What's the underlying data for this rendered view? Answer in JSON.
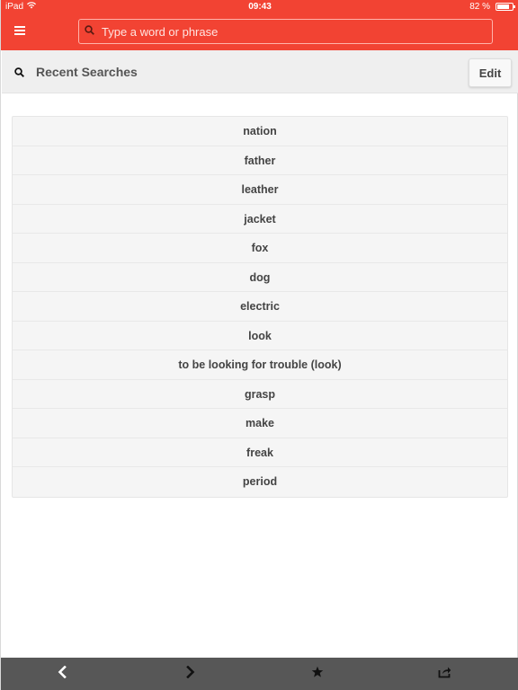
{
  "status_bar": {
    "device": "iPad",
    "time": "09:43",
    "battery_text": "82 %",
    "battery_level": 0.82
  },
  "toolbar": {
    "menu_icon": "hamburger-icon",
    "search": {
      "placeholder": "Type a word or phrase",
      "value": "",
      "icon": "search-icon"
    }
  },
  "header": {
    "icon": "search-icon",
    "title": "Recent Searches",
    "edit_label": "Edit"
  },
  "recent_searches": [
    "nation",
    "father",
    "leather",
    "jacket",
    "fox",
    "dog",
    "electric",
    "look",
    "to be looking for trouble (look)",
    "grasp",
    "make",
    "freak",
    "period"
  ],
  "bottom_bar": {
    "buttons": [
      "back-icon",
      "forward-icon",
      "star-icon",
      "share-icon"
    ]
  },
  "colors": {
    "accent": "#f24333",
    "bottom_bar": "#575757",
    "header_bg": "#efefef"
  }
}
